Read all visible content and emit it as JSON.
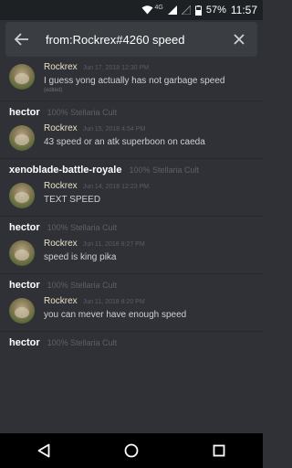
{
  "status_bar": {
    "network": "4G",
    "battery": "57%",
    "time": "11:57"
  },
  "search": {
    "query": "from:Rockrex#4260 speed"
  },
  "results": [
    {
      "channel": "",
      "server": "",
      "author": "Rockrex",
      "timestamp": "Jun 17, 2018 12:30 PM",
      "text": "I guess yong actually has not garbage speed",
      "edited": "(edited)"
    },
    {
      "channel": "hector",
      "server": "100% Stellaria Cult",
      "author": "Rockrex",
      "timestamp": "Jun 15, 2018 4:54 PM",
      "text": "43 speed or an atk superboon on caeda",
      "edited": ""
    },
    {
      "channel": "xenoblade-battle-royale",
      "server": "100% Stellaria Cult",
      "author": "Rockrex",
      "timestamp": "Jun 14, 2018 12:23 PM",
      "text": "TEXT SPEED",
      "edited": ""
    },
    {
      "channel": "hector",
      "server": "100% Stellaria Cult",
      "author": "Rockrex",
      "timestamp": "Jun 11, 2018 8:27 PM",
      "text": "speed is king pika",
      "edited": ""
    },
    {
      "channel": "hector",
      "server": "100% Stellaria Cult",
      "author": "Rockrex",
      "timestamp": "Jun 11, 2018 8:20 PM",
      "text": "you can mever have enough speed",
      "edited": ""
    },
    {
      "channel": "hector",
      "server": "100% Stellaria Cult",
      "author": "",
      "timestamp": "",
      "text": "",
      "edited": ""
    }
  ],
  "icons": {
    "back": "arrow-left-icon",
    "clear": "close-icon",
    "nav_back": "triangle-back-icon",
    "nav_home": "circle-home-icon",
    "nav_recents": "square-recents-icon"
  }
}
